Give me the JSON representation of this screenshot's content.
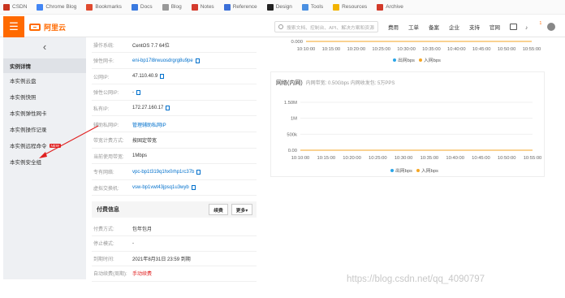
{
  "bookmarks": [
    {
      "label": "CSDN",
      "color": "#c8341f"
    },
    {
      "label": "Chrome Blog",
      "color": "#4285f4"
    },
    {
      "label": "Bookmarks",
      "color": "#e04a2f"
    },
    {
      "label": "Docs",
      "color": "#3a7ae0"
    },
    {
      "label": "Blog",
      "color": "#999999"
    },
    {
      "label": "Notes",
      "color": "#d43b2d"
    },
    {
      "label": "Reference",
      "color": "#3b6fd8"
    },
    {
      "label": "Design",
      "color": "#222222"
    },
    {
      "label": "Tools",
      "color": "#4a90e2"
    },
    {
      "label": "Resources",
      "color": "#f2b300"
    },
    {
      "label": "Archive",
      "color": "#d23a2a"
    }
  ],
  "header": {
    "menu_glyph": "☰",
    "logo_text": "阿里云",
    "search_placeholder": "搜索文档、控制台、API、解决方案和资源",
    "nav": [
      "费用",
      "工单",
      "备案",
      "企业",
      "支持",
      "官网"
    ],
    "bell_glyph": "♪",
    "bell_count": "1",
    "accent": "#ff6a00"
  },
  "sidebar": {
    "back_glyph": "‹",
    "items": [
      {
        "label": "实例详情",
        "active": true
      },
      {
        "label": "本实例云盘"
      },
      {
        "label": "本实例快照"
      },
      {
        "label": "本实例弹性网卡"
      },
      {
        "label": "本实例操作记录"
      },
      {
        "label": "本实例远程命令",
        "badge": "NEW"
      },
      {
        "label": "本实例安全组"
      }
    ]
  },
  "details": {
    "rows": [
      {
        "label": "操作系统:",
        "value": "CentOS 7.7 64位"
      },
      {
        "label": "弹性网卡:",
        "value": "eni-bp17l8rwuosdrgrg8u9pe",
        "link": true,
        "copy": true
      },
      {
        "label": "公网IP:",
        "value": "47.110.40.9",
        "copy": true
      },
      {
        "label": "弹性公网IP:",
        "value": "-",
        "copy": true
      },
      {
        "label": "私有IP:",
        "value": "172.27.160.17",
        "copy": true
      },
      {
        "label": "辅助私网IP:",
        "value": "管理辅助私网IP",
        "link": true
      },
      {
        "label": "带宽计费方式:",
        "value": "按固定带宽"
      },
      {
        "label": "当前使用带宽:",
        "value": "1Mbps"
      },
      {
        "label": "专有网络:",
        "value": "vpc-bp1t319q1hx0rhp1rc37b",
        "link": true,
        "copy": true
      },
      {
        "label": "虚拟交换机:",
        "value": "vsw-bp1vwt43jpsq1u3wyb",
        "link": true,
        "copy": true
      }
    ],
    "billing": {
      "title": "付费信息",
      "renew_label": "续费",
      "more_label": "更多▾",
      "rows": [
        {
          "label": "付费方式:",
          "value": "包年包月"
        },
        {
          "label": "停止模式:",
          "value": "-"
        },
        {
          "label": "到期时间:",
          "value": "2021年8月31日 23:59 到期"
        },
        {
          "label": "自动续费(周期):",
          "value": "手动续费",
          "red": true
        }
      ]
    }
  },
  "chart_data": [
    {
      "type": "line",
      "title": "",
      "categories": [
        "10:10:00",
        "10:15:00",
        "10:20:00",
        "10:25:00",
        "10:30:00",
        "10:35:00",
        "10:40:00",
        "10:45:00",
        "10:50:00",
        "10:55:00"
      ],
      "yticks": [
        "0.000"
      ],
      "ylim": [
        0,
        0
      ],
      "series": [
        {
          "name": "出网bps",
          "color": "#2aa6e8",
          "values": [
            0,
            0,
            0,
            0,
            0,
            0,
            0,
            0,
            0,
            0
          ]
        },
        {
          "name": "入网bps",
          "color": "#f5a623",
          "values": [
            0,
            0,
            0,
            0,
            0,
            0,
            0,
            0,
            0,
            0
          ]
        }
      ]
    },
    {
      "type": "line",
      "title": "网络(内网)",
      "subtitle": "内网带宽: 0.50Gbps 内网收发包: 5万PPS",
      "categories": [
        "10:10:00",
        "10:15:00",
        "10:20:00",
        "10:25:00",
        "10:30:00",
        "10:35:00",
        "10:40:00",
        "10:45:00",
        "10:50:00",
        "10:55:00"
      ],
      "yticks": [
        "0.00",
        "500k",
        "1M",
        "1.50M"
      ],
      "ylim": [
        0,
        1500000
      ],
      "grid": true,
      "series": [
        {
          "name": "出网bps",
          "color": "#2aa6e8",
          "values": [
            0,
            0,
            0,
            0,
            0,
            0,
            0,
            0,
            0,
            0
          ]
        },
        {
          "name": "入网bps",
          "color": "#f5a623",
          "values": [
            0,
            0,
            0,
            0,
            0,
            0,
            0,
            0,
            0,
            0
          ]
        }
      ]
    }
  ],
  "annotation": {
    "color": "#e02020"
  },
  "watermark": "https://blog.csdn.net/qq_4090797"
}
